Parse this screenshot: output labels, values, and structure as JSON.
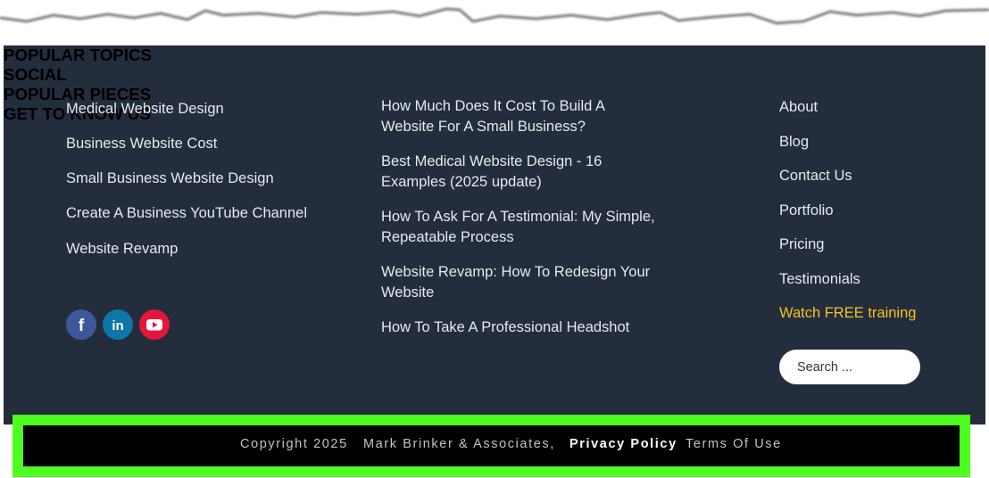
{
  "popular_topics": {
    "heading": "POPULAR TOPICS",
    "items": [
      "Medical Website Design",
      "Business Website Cost",
      "Small Business Website Design",
      "Create A Business YouTube Channel",
      "Website Revamp"
    ]
  },
  "social": {
    "heading": "SOCIAL",
    "icons": [
      {
        "name": "facebook-icon",
        "glyph": "f",
        "color": "#3b5998"
      },
      {
        "name": "linkedin-icon",
        "glyph": "in",
        "color": "#0e76a8"
      },
      {
        "name": "youtube-icon",
        "glyph": "▶",
        "color": "#e4163a"
      }
    ]
  },
  "popular_pieces": {
    "heading": "POPULAR PIECES",
    "items": [
      {
        "line1": "How Much Does It Cost To Build A",
        "line2": "Website For A Small Business?"
      },
      {
        "line1": "Best Medical Website Design - 16",
        "line2": "Examples (2025 update)"
      },
      {
        "line1": "How To Ask For A Testimonial: My Simple,",
        "line2": "Repeatable Process"
      },
      {
        "line1": "Website Revamp: How To Redesign Your",
        "line2": "Website"
      },
      {
        "line1": "How To Take A Professional Headshot",
        "line2": ""
      }
    ]
  },
  "get_to_know_us": {
    "heading": "GET TO KNOW US",
    "items": [
      "About",
      "Blog",
      "Contact Us",
      "Portfolio",
      "Pricing",
      "Testimonials"
    ],
    "highlight": "Watch FREE training",
    "highlight_color": "#f6c026"
  },
  "search": {
    "placeholder": "Search ..."
  },
  "bottom_bar": {
    "copyright": "Copyright 2025",
    "company": "Mark Brinker & Associates,",
    "privacy": "Privacy Policy",
    "terms": "Terms Of Use",
    "border_color": "#4dff1f"
  },
  "colors": {
    "footer_bg": "#232d3c",
    "bottom_bg": "#000000"
  }
}
